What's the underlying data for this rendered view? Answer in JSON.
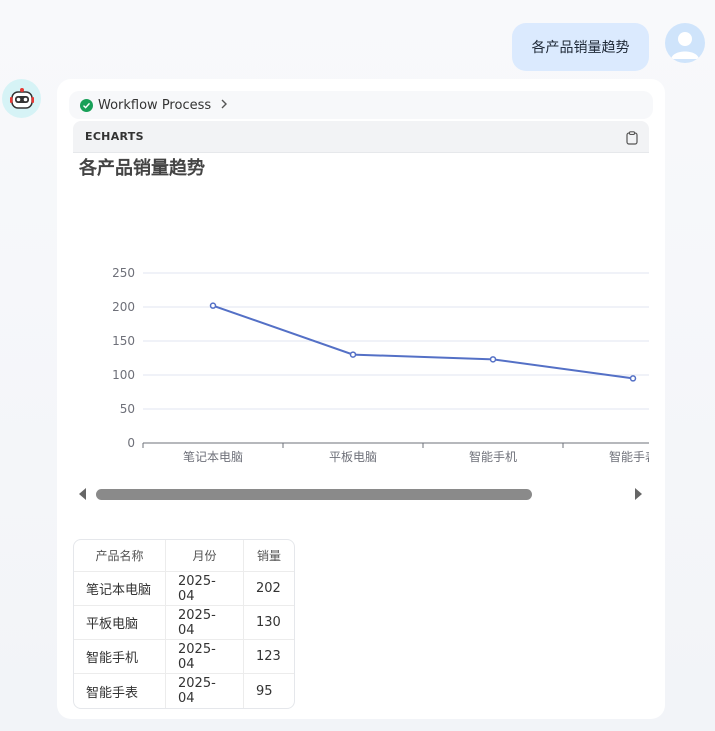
{
  "user_message": "各产品销量趋势",
  "workflow": {
    "label": "Workflow Process"
  },
  "echarts": {
    "label": "ECHARTS",
    "copy_icon": "clipboard-icon"
  },
  "chart_data": {
    "type": "line",
    "title": "各产品销量趋势",
    "categories": [
      "笔记本电脑",
      "平板电脑",
      "智能手机",
      "智能手表"
    ],
    "series": [
      {
        "values": [
          202,
          130,
          123,
          95
        ]
      }
    ],
    "ylim": [
      0,
      250
    ],
    "yticks": [
      0,
      50,
      100,
      150,
      200,
      250
    ],
    "grid": true,
    "color": "#5470c6",
    "xlabel": "",
    "ylabel": ""
  },
  "table": {
    "headers": [
      "产品名称",
      "月份",
      "销量"
    ],
    "rows": [
      [
        "笔记本电脑",
        "2025-04",
        "202"
      ],
      [
        "平板电脑",
        "2025-04",
        "130"
      ],
      [
        "智能手机",
        "2025-04",
        "123"
      ],
      [
        "智能手表",
        "2025-04",
        "95"
      ]
    ]
  }
}
